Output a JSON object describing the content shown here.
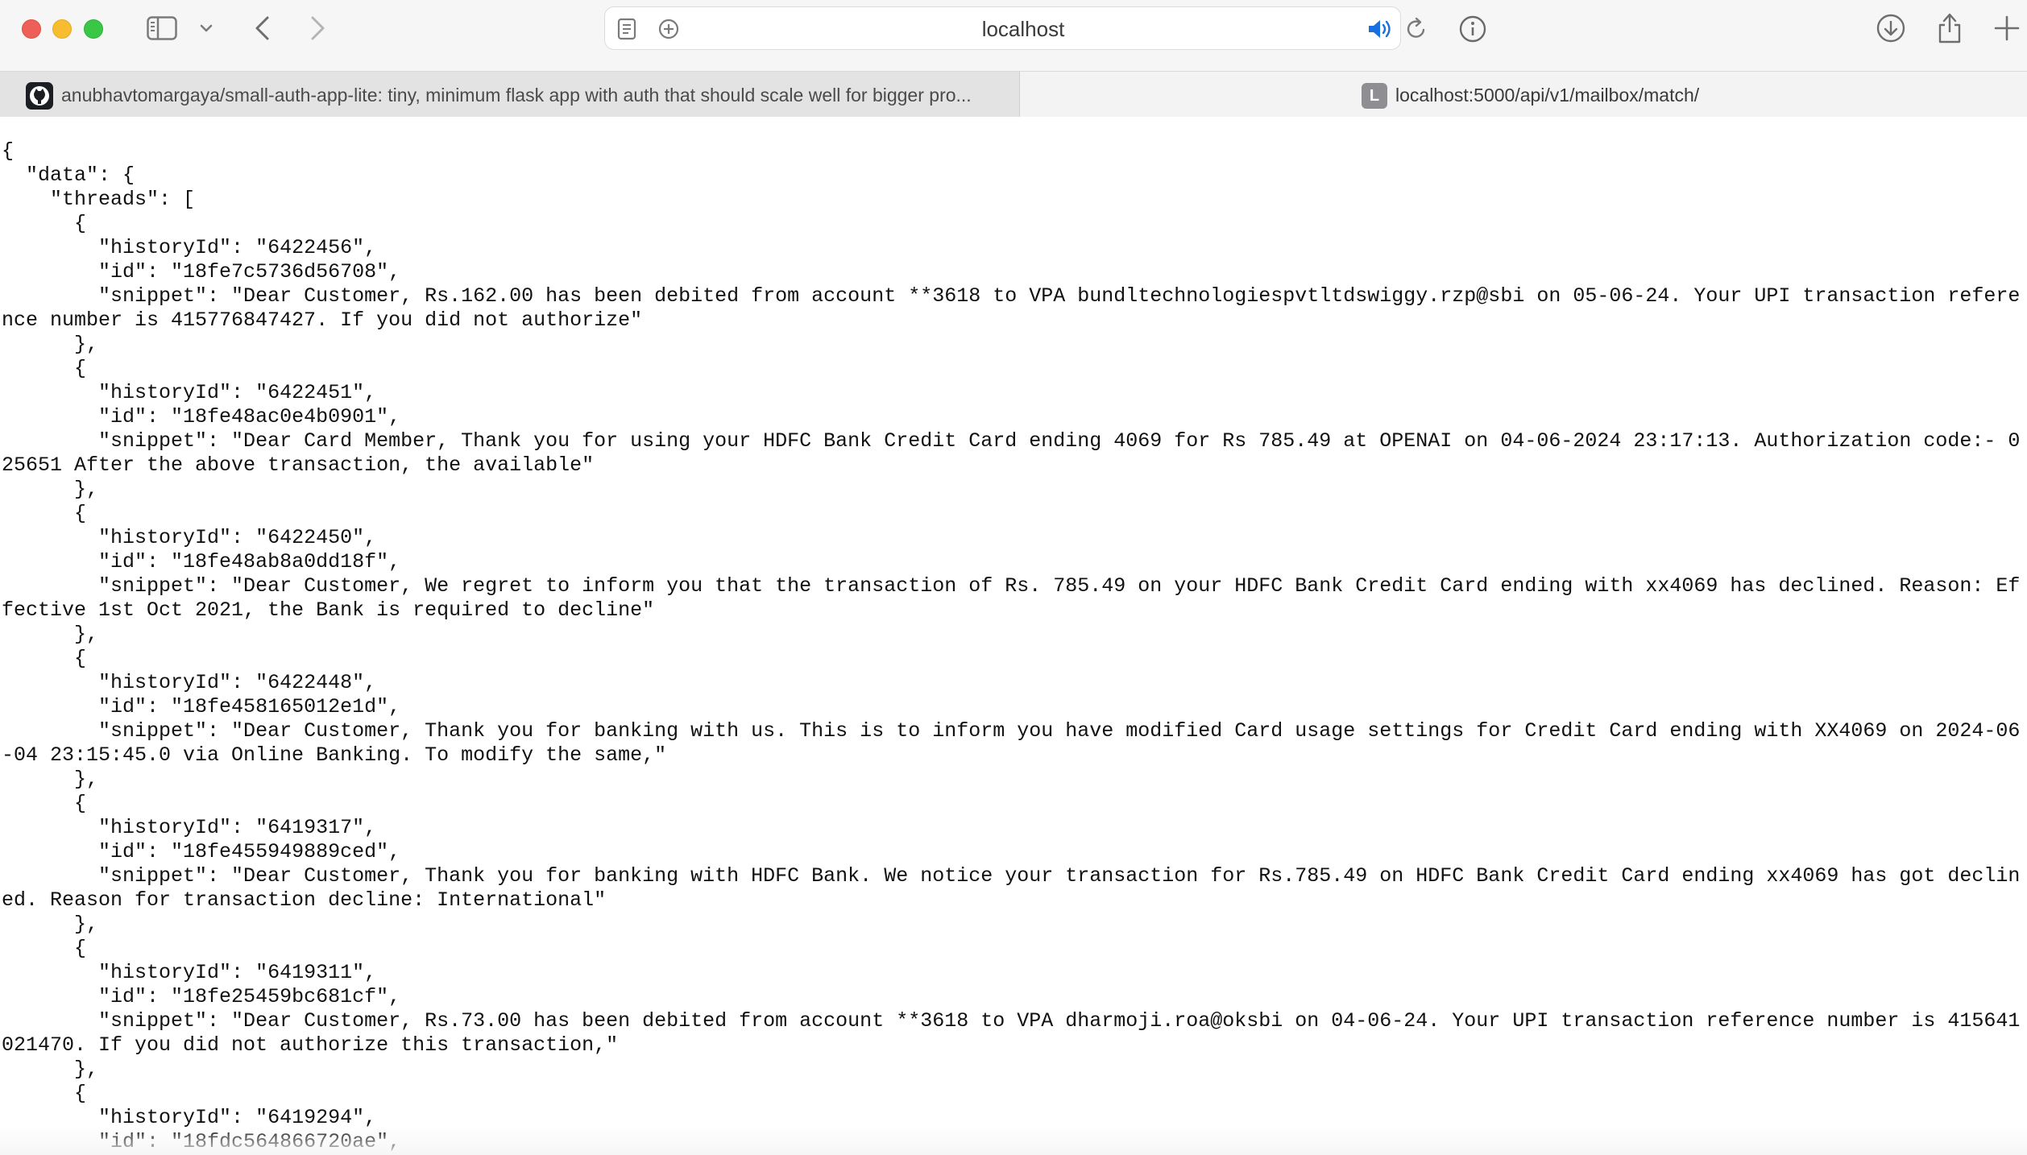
{
  "browser": {
    "address": "localhost",
    "tabs": [
      {
        "title": "anubhavtomargaya/small-auth-app-lite: tiny, minimum flask app with auth that should scale well for bigger pro...",
        "favicon": "github-icon"
      },
      {
        "title": "localhost:5000/api/v1/mailbox/match/",
        "favicon_letter": "L"
      }
    ]
  },
  "page": {
    "lines": [
      "{",
      "  \"data\": {",
      "    \"threads\": [",
      "      {",
      "        \"historyId\": \"6422456\",",
      "        \"id\": \"18fe7c5736d56708\",",
      "        \"snippet\": \"Dear Customer, Rs.162.00 has been debited from account **3618 to VPA bundltechnologiespvtltdswiggy.rzp@sbi on 05-06-24. Your UPI transaction reference number is 415776847427. If you did not authorize\"",
      "      },",
      "      {",
      "        \"historyId\": \"6422451\",",
      "        \"id\": \"18fe48ac0e4b0901\",",
      "        \"snippet\": \"Dear Card Member, Thank you for using your HDFC Bank Credit Card ending 4069 for Rs 785.49 at OPENAI on 04-06-2024 23:17:13. Authorization code:- 025651 After the above transaction, the available\"",
      "      },",
      "      {",
      "        \"historyId\": \"6422450\",",
      "        \"id\": \"18fe48ab8a0dd18f\",",
      "        \"snippet\": \"Dear Customer, We regret to inform you that the transaction of Rs. 785.49 on your HDFC Bank Credit Card ending with xx4069 has declined. Reason: Effective 1st Oct 2021, the Bank is required to decline\"",
      "      },",
      "      {",
      "        \"historyId\": \"6422448\",",
      "        \"id\": \"18fe458165012e1d\",",
      "        \"snippet\": \"Dear Customer, Thank you for banking with us. This is to inform you have modified Card usage settings for Credit Card ending with XX4069 on 2024-06-04 23:15:45.0 via Online Banking. To modify the same,\"",
      "      },",
      "      {",
      "        \"historyId\": \"6419317\",",
      "        \"id\": \"18fe455949889ced\",",
      "        \"snippet\": \"Dear Customer, Thank you for banking with HDFC Bank. We notice your transaction for Rs.785.49 on HDFC Bank Credit Card ending xx4069 has got declined. Reason for transaction decline: International\"",
      "      },",
      "      {",
      "        \"historyId\": \"6419311\",",
      "        \"id\": \"18fe25459bc681cf\",",
      "        \"snippet\": \"Dear Customer, Rs.73.00 has been debited from account **3618 to VPA dharmoji.roa@oksbi on 04-06-24. Your UPI transaction reference number is 415641021470. If you did not authorize this transaction,\"",
      "      },",
      "      {",
      "        \"historyId\": \"6419294\",",
      "        \"id\": \"18fdc564866720ae\","
    ]
  }
}
